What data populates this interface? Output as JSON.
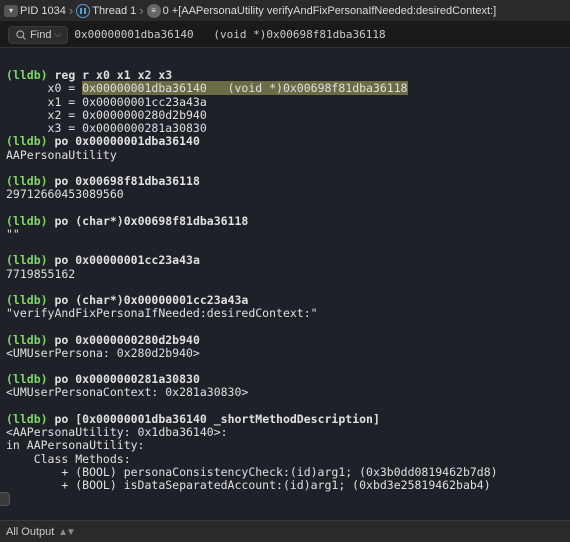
{
  "breadcrumb": {
    "pid_label": "PID 1034",
    "thread_label": "Thread 1",
    "frame_label": "0 +[AAPersonaUtility verifyAndFixPersonaIfNeeded:desiredContext:]"
  },
  "find": {
    "button_label": "Find",
    "value": "0x00000001dba36140   (void *)0x00698f81dba36118"
  },
  "console": {
    "cmd0": "reg r x0 x1 x2 x3",
    "r0_prefix": "      x0 = ",
    "r0_hl": "0x00000001dba36140   (void *)0x00698f81dba36118",
    "r1": "      x1 = 0x00000001cc23a43a",
    "r2": "      x2 = 0x0000000280d2b940",
    "r3": "      x3 = 0x0000000281a30830",
    "cmd1": "po 0x00000001dba36140",
    "out1": "AAPersonaUtility",
    "cmd2": "po 0x00698f81dba36118",
    "out2": "29712660453089560",
    "cmd3": "po (char*)0x00698f81dba36118",
    "out3": "\"\"",
    "cmd4": "po 0x00000001cc23a43a",
    "out4": "7719855162",
    "cmd5": "po (char*)0x00000001cc23a43a",
    "out5": "\"verifyAndFixPersonaIfNeeded:desiredContext:\"",
    "cmd6": "po 0x0000000280d2b940",
    "out6": "<UMUserPersona: 0x280d2b940>",
    "cmd7": "po 0x0000000281a30830",
    "out7": "<UMUserPersonaContext: 0x281a30830>",
    "cmd8": "po [0x00000001dba36140 _shortMethodDescription]",
    "out8a": "<AAPersonaUtility: 0x1dba36140>:",
    "out8b": "in AAPersonaUtility:",
    "out8c": "    Class Methods:",
    "out8d": "        + (BOOL) personaConsistencyCheck:(id)arg1; (0x3b0dd0819462b7d8)",
    "out8e": "        + (BOOL) isDataSeparatedAccount:(id)arg1; (0xbd3e25819462bab4)"
  },
  "bottom": {
    "selector": "All Output"
  }
}
